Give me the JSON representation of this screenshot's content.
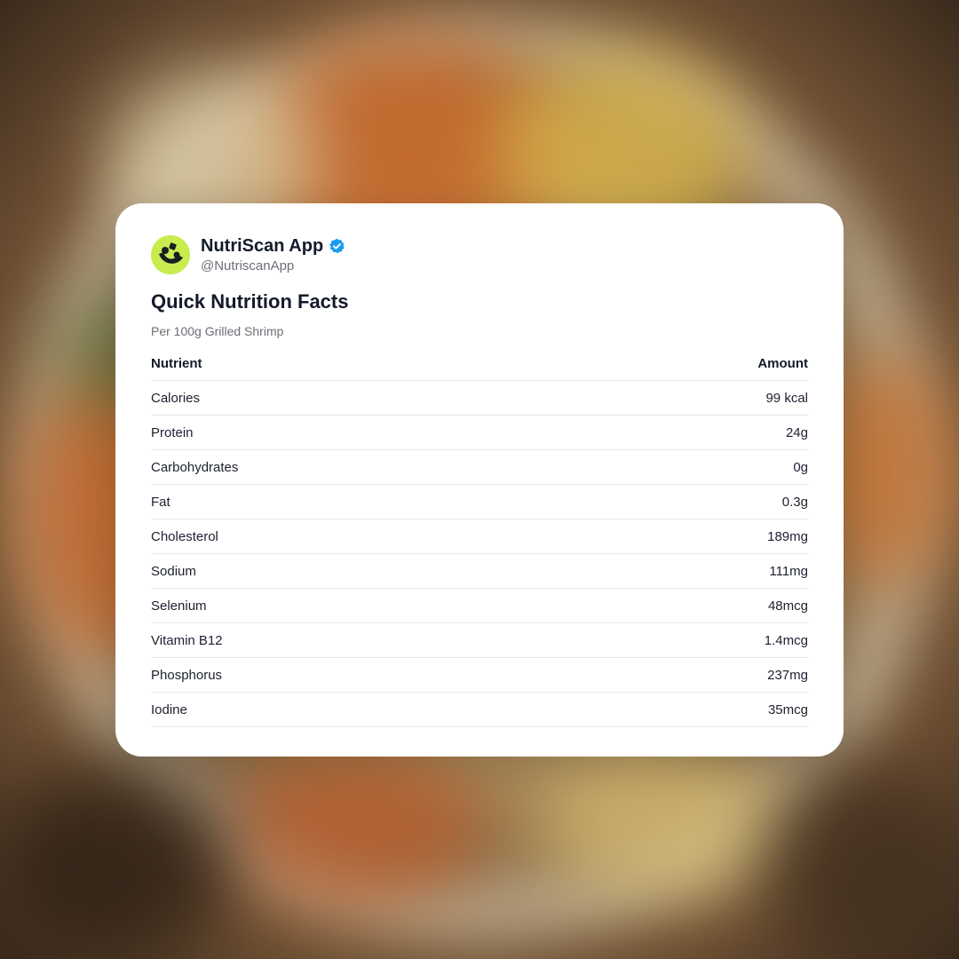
{
  "profile": {
    "name": "NutriScan App",
    "handle": "@NutriscanApp",
    "avatar_icon": "leaf-logo-icon",
    "verified_icon": "verified-badge-icon"
  },
  "card": {
    "title": "Quick Nutrition Facts",
    "subtitle": "Per 100g Grilled Shrimp"
  },
  "table": {
    "headers": [
      "Nutrient",
      "Amount"
    ],
    "rows": [
      {
        "nutrient": "Calories",
        "amount": "99 kcal"
      },
      {
        "nutrient": "Protein",
        "amount": "24g"
      },
      {
        "nutrient": "Carbohydrates",
        "amount": "0g"
      },
      {
        "nutrient": "Fat",
        "amount": "0.3g"
      },
      {
        "nutrient": "Cholesterol",
        "amount": "189mg"
      },
      {
        "nutrient": "Sodium",
        "amount": "111mg"
      },
      {
        "nutrient": "Selenium",
        "amount": "48mcg"
      },
      {
        "nutrient": "Vitamin B12",
        "amount": "1.4mcg"
      },
      {
        "nutrient": "Phosphorus",
        "amount": "237mg"
      },
      {
        "nutrient": "Iodine",
        "amount": "35mcg"
      }
    ]
  },
  "colors": {
    "avatar_bg": "#c8ec4e",
    "verified_blue": "#1d9bf0",
    "text_primary": "#141a2a",
    "text_secondary": "#6b6f76"
  }
}
